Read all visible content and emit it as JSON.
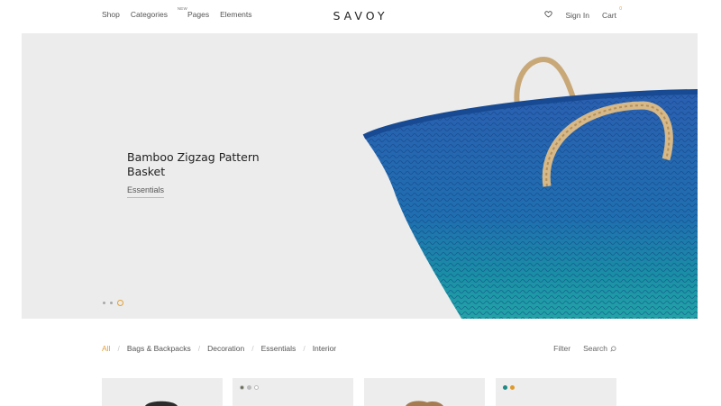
{
  "header": {
    "logo": "SAVOY",
    "nav_left": [
      {
        "label": "Shop"
      },
      {
        "label": "Categories",
        "badge": "NEW"
      },
      {
        "label": "Pages"
      },
      {
        "label": "Elements"
      }
    ],
    "sign_in": "Sign In",
    "cart_label": "Cart",
    "cart_count": "0",
    "wishlist_icon": "heart-icon"
  },
  "hero": {
    "title": "Bamboo Zigzag Pattern Basket",
    "category": "Essentials",
    "slides": 3,
    "active_slide": 3,
    "background": "#ececec",
    "accent": "#e0a23c"
  },
  "filters": {
    "items": [
      "All",
      "Bags & Backpacks",
      "Decoration",
      "Essentials",
      "Interior"
    ],
    "active": "All",
    "filter_label": "Filter",
    "search_label": "Search",
    "search_icon": "search-icon"
  },
  "products": [
    {
      "swatches": []
    },
    {
      "swatches": [
        "#6b6b56",
        "#bdbdbd",
        "#ffffff"
      ]
    },
    {
      "swatches": []
    },
    {
      "swatches": [
        "#1f8a86",
        "#e09a2a"
      ]
    }
  ]
}
